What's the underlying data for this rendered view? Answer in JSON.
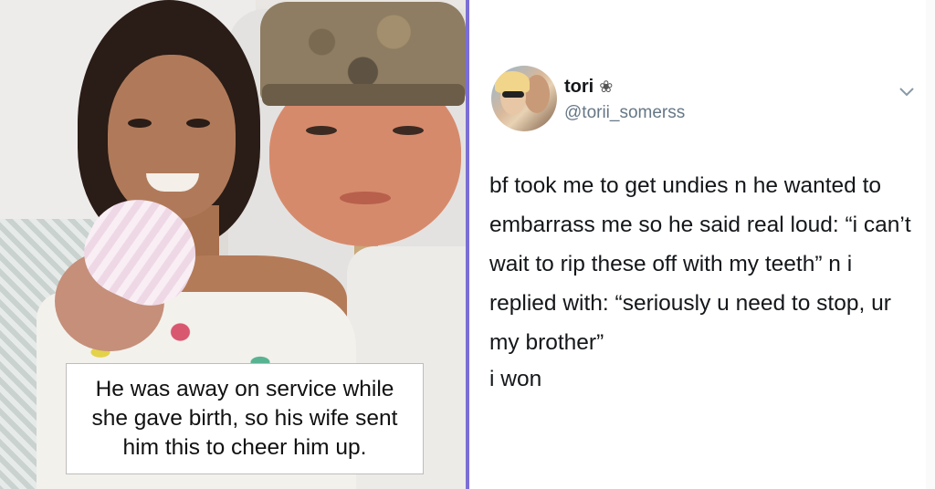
{
  "photo": {
    "caption": "He was away on service while she gave birth, so his wife sent him this to cheer him up."
  },
  "tweet": {
    "display_name": "tori",
    "badge": "❀",
    "handle": "@torii_somerss",
    "menu_icon": "chevron-down-icon",
    "body": "bf took me to get undies n he wanted to embarrass me so he said real loud: “i can’t wait to rip these off with my teeth” n i replied with: “seriously u need to stop, ur my brother”",
    "footer": "i won"
  },
  "colors": {
    "divider": "#7b6fd6"
  }
}
